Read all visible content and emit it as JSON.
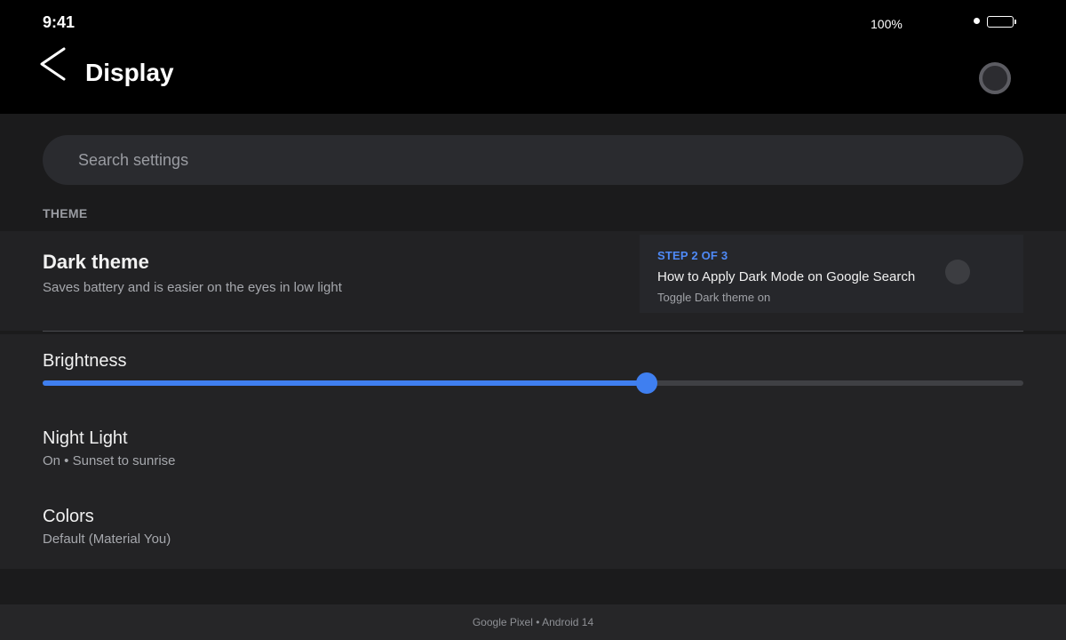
{
  "status_bar": {
    "time": "9:41",
    "battery_percent": "100%",
    "battery_icon": "battery-icon"
  },
  "header": {
    "back_icon": "chevron-left-icon",
    "title": "Display",
    "profile_icon": "account-circle-icon"
  },
  "search": {
    "placeholder": "Search settings",
    "value": ""
  },
  "theme_section": {
    "header": "THEME",
    "dark_theme": {
      "title": "Dark theme",
      "subtitle": "Saves battery and is easier on the eyes in low light",
      "toggle_on": false
    },
    "tutorial": {
      "step": "STEP 2 OF 3",
      "title": "How to Apply Dark Mode on Google Search",
      "instruction": "Toggle Dark theme on"
    }
  },
  "brightness": {
    "label": "Brightness",
    "level_percent": 61.6
  },
  "items": [
    {
      "title": "Night Light",
      "subtitle": "On • Sunset to sunrise"
    },
    {
      "title": "Colors",
      "subtitle": "Default (Material You)"
    }
  ],
  "footer": {
    "device": "Google Pixel • Android 14"
  },
  "colors": {
    "accent": "#3f7ff0",
    "step_label": "#4f8af7",
    "background": "#1b1b1c",
    "app_bar": "#000000"
  }
}
